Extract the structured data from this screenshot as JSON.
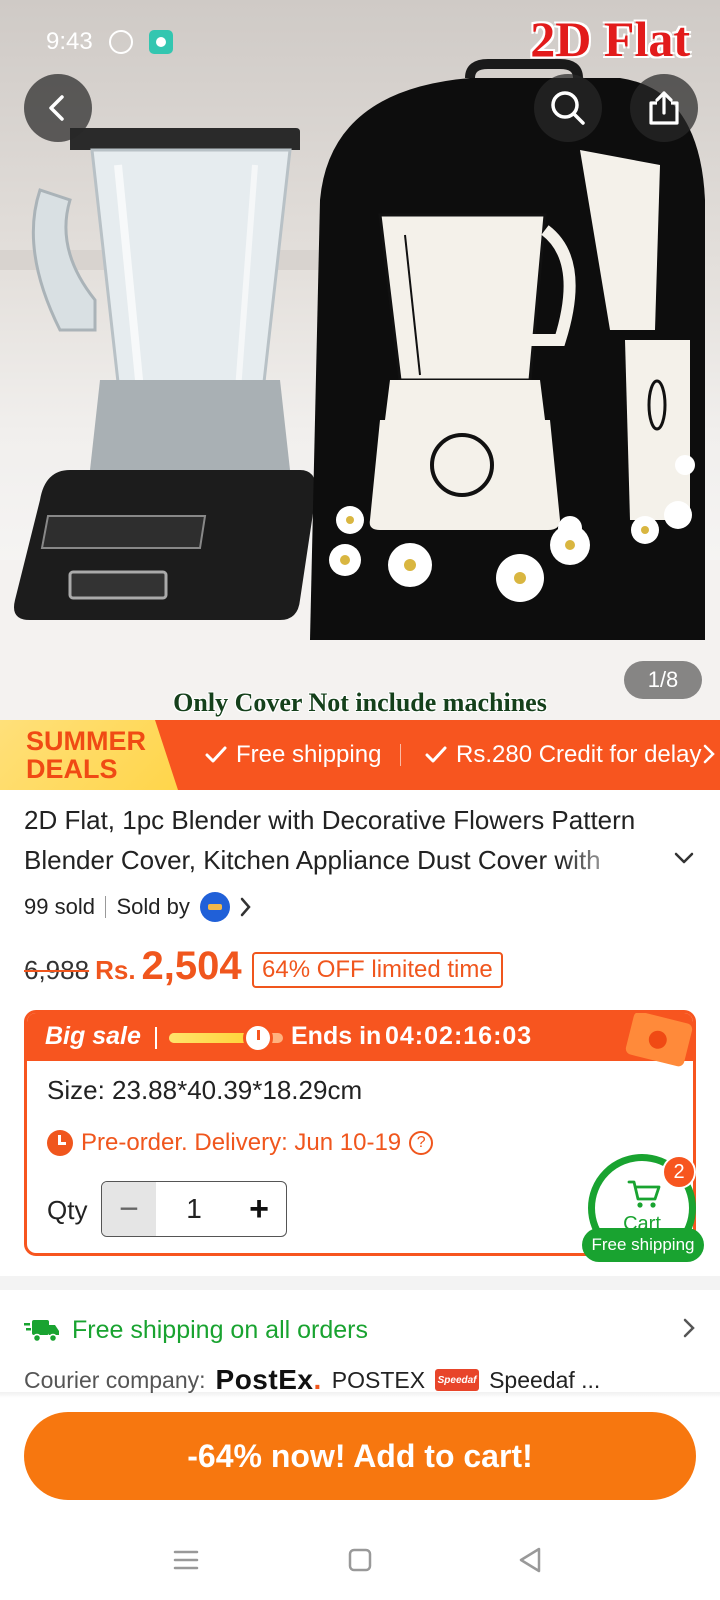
{
  "status_bar": {
    "time": "9:43",
    "icons": [
      "whatsapp-icon",
      "app-notification-icon"
    ]
  },
  "product_image": {
    "watermark": "2D Flat",
    "caption": "Only Cover Not include machines",
    "counter": "1/8",
    "current_index": 1,
    "total_images": 8
  },
  "header_actions": {
    "back_icon": "chevron-left-icon",
    "search_icon": "search-icon",
    "share_icon": "share-icon"
  },
  "deals_banner": {
    "badge_line1": "SUMMER",
    "badge_line2": "DEALS",
    "perks": [
      "Free shipping",
      "Rs.280 Credit for delay"
    ]
  },
  "product": {
    "title": "2D Flat, 1pc Blender with Decorative Flowers Pattern Blender Cover, Kitchen Appliance Dust Cover with",
    "sold": "99 sold",
    "sold_by": "Sold by",
    "old_price": "6,988",
    "currency": "Rs.",
    "price": "2,504",
    "discount": "64% OFF limited time"
  },
  "big_sale": {
    "label": "Big sale",
    "progress": 0.8,
    "ends_in_label": "Ends in",
    "timer": "04:02:16:03",
    "size": "Size: 23.88*40.39*18.29cm",
    "preorder": "Pre-order. Delivery: Jun 10-19",
    "help": "?",
    "qty_label": "Qty",
    "qty_value": "1",
    "minus": "−",
    "plus": "+"
  },
  "cart": {
    "label": "Cart",
    "count": "2",
    "free_shipping": "Free shipping"
  },
  "shipping": {
    "title": "Free shipping on all orders",
    "courier_label": "Courier company:",
    "courier_logo": "PostEx",
    "courier_logo_dot": ".",
    "courier_name": "POSTEX",
    "speedaf_logo": "Speedaf",
    "speedaf_more": "Speedaf ..."
  },
  "cta": {
    "label": "-64% now! Add to cart!"
  },
  "colors": {
    "accent": "#f7551f",
    "button": "#f7770f",
    "success": "#19a330"
  }
}
